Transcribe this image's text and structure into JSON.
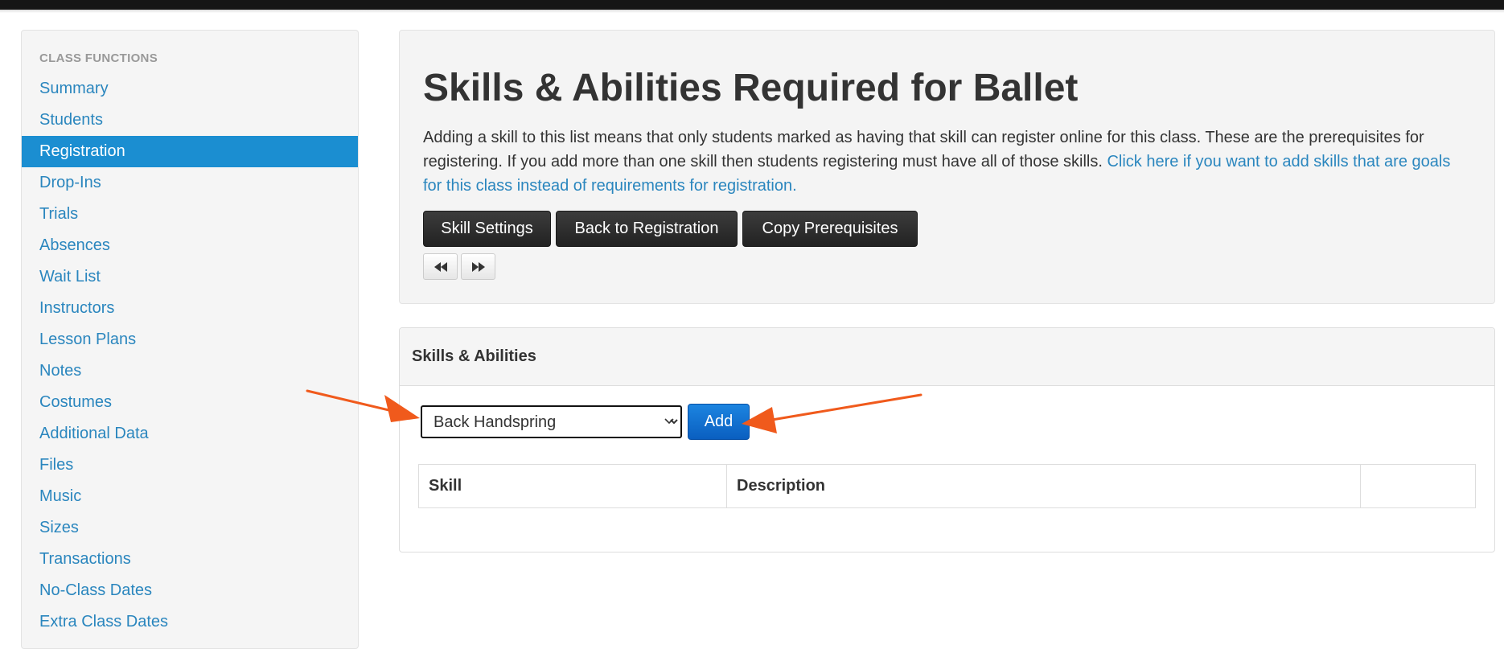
{
  "sidebar": {
    "header": "CLASS FUNCTIONS",
    "items": [
      {
        "label": "Summary"
      },
      {
        "label": "Students"
      },
      {
        "label": "Registration",
        "active": true
      },
      {
        "label": "Drop-Ins"
      },
      {
        "label": "Trials"
      },
      {
        "label": "Absences"
      },
      {
        "label": "Wait List"
      },
      {
        "label": "Instructors"
      },
      {
        "label": "Lesson Plans"
      },
      {
        "label": "Notes"
      },
      {
        "label": "Costumes"
      },
      {
        "label": "Additional Data"
      },
      {
        "label": "Files"
      },
      {
        "label": "Music"
      },
      {
        "label": "Sizes"
      },
      {
        "label": "Transactions"
      },
      {
        "label": "No-Class Dates"
      },
      {
        "label": "Extra Class Dates"
      }
    ]
  },
  "hero": {
    "title": "Skills & Abilities Required for Ballet",
    "intro_text": "Adding a skill to this list means that only students marked as having that skill can register online for this class. These are the prerequisites for registering. If you add more than one skill then students registering must have all of those skills.",
    "intro_link": "Click here if you want to add skills that are goals for this class instead of requirements for registration.",
    "buttons": {
      "skill_settings": "Skill Settings",
      "back_to_registration": "Back to Registration",
      "copy_prerequisites": "Copy Prerequisites"
    },
    "nav_icons": {
      "previous": "fast-backward-icon",
      "next": "fast-forward-icon"
    }
  },
  "panel": {
    "title": "Skills & Abilities",
    "select_value": "Back Handspring",
    "add_label": "Add",
    "table": {
      "headers": [
        "Skill",
        "Description",
        ""
      ]
    }
  },
  "annotations": {
    "arrow_color": "#f05a1c"
  },
  "colors": {
    "link": "#2a86be",
    "active_bg": "#1b8ed1",
    "primary_button": "#0a6fd6",
    "dark_button": "#333333"
  }
}
